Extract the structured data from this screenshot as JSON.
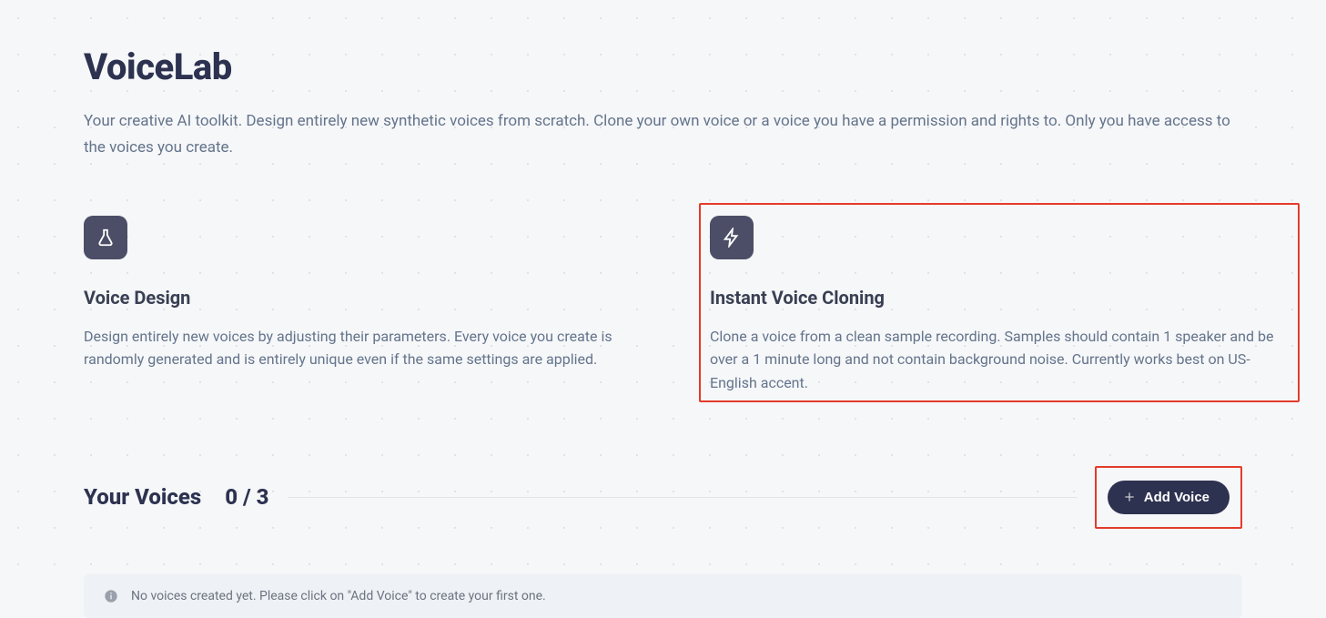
{
  "page": {
    "title": "VoiceLab",
    "description": "Your creative AI toolkit. Design entirely new synthetic voices from scratch. Clone your own voice or a voice you have a permission and rights to. Only you have access to the voices you create."
  },
  "cards": {
    "design": {
      "title": "Voice Design",
      "description": "Design entirely new voices by adjusting their parameters. Every voice you create is randomly generated and is entirely unique even if the same settings are applied."
    },
    "cloning": {
      "title": "Instant Voice Cloning",
      "description": "Clone a voice from a clean sample recording. Samples should contain 1 speaker and be over a 1 minute long and not contain background noise. Currently works best on US-English accent."
    }
  },
  "voices_section": {
    "title": "Your Voices",
    "count": "0 / 3",
    "add_button": "Add Voice",
    "empty_notice": "No voices created yet. Please click on \"Add Voice\" to create your first one."
  }
}
